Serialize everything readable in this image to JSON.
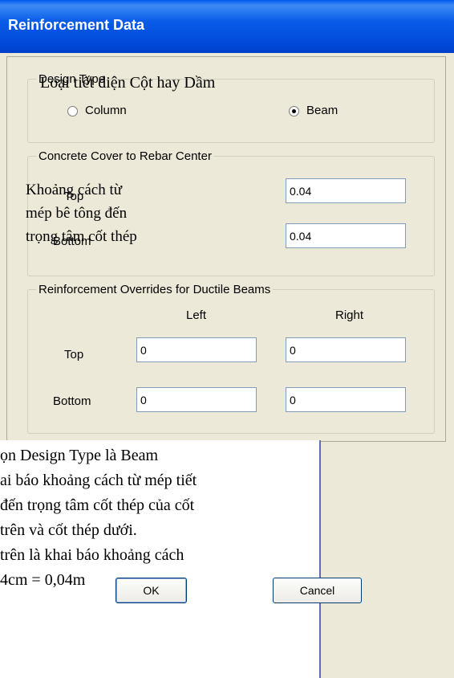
{
  "window": {
    "title": "Reinforcement Data"
  },
  "design_type": {
    "legend": "Design Type",
    "options": [
      {
        "label": "Column",
        "selected": false
      },
      {
        "label": "Beam",
        "selected": true
      }
    ]
  },
  "concrete_cover": {
    "legend": "Concrete Cover to Rebar Center",
    "rows": [
      {
        "label": "Top",
        "value": "0.04"
      },
      {
        "label": "Bottom",
        "value": "0.04"
      }
    ]
  },
  "overrides": {
    "legend": "Reinforcement Overrides for Ductile Beams",
    "col_left": "Left",
    "col_right": "Right",
    "rows": [
      {
        "label": "Top",
        "left": "0",
        "right": "0"
      },
      {
        "label": "Bottom",
        "left": "0",
        "right": "0"
      }
    ]
  },
  "buttons": {
    "ok": "OK",
    "cancel": "Cancel"
  },
  "annotations": {
    "design_type_note": "Loại tiết diện Cột hay Dầm",
    "cover_note": [
      "Khoảng    cách    từ",
      "mép  bê  tông  đến",
      "trọng tâm cốt thép"
    ],
    "bottom_note": [
      "ọn Design Type là Beam",
      "ai báo khoảng cách từ mép tiết",
      " đến trọng tâm cốt thép của cốt",
      "trên và cốt thép dưới.",
      " trên là khai báo khoảng cách",
      " 4cm = 0,04m"
    ]
  },
  "colors": {
    "title_bar": "#0a5ce8",
    "dialog_bg": "#ece9d8",
    "annotation_line": "#5b6fb8"
  }
}
